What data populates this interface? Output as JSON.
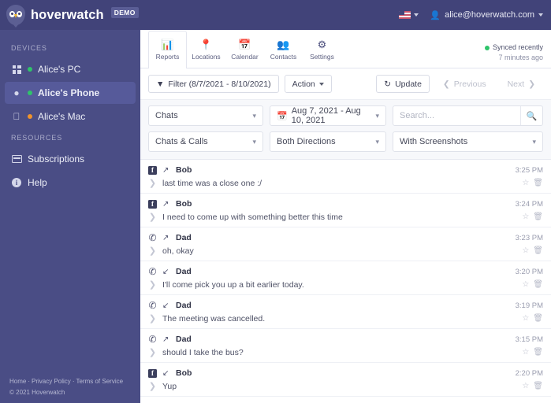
{
  "topbar": {
    "brand": "hoverwatch",
    "demo_badge": "DEMO",
    "language_icon": "us-flag-icon",
    "account_icon": "user-icon",
    "account_email": "alice@hoverwatch.com"
  },
  "sidebar": {
    "devices_heading": "DEVICES",
    "devices": [
      {
        "label": "Alice's PC",
        "icon": "windows-icon",
        "status": "green",
        "active": false
      },
      {
        "label": "Alice's Phone",
        "icon": "android-icon",
        "status": "green",
        "active": true
      },
      {
        "label": "Alice's Mac",
        "icon": "apple-icon",
        "status": "orange",
        "active": false
      }
    ],
    "resources_heading": "RESOURCES",
    "resources": [
      {
        "label": "Subscriptions",
        "icon": "card-icon"
      },
      {
        "label": "Help",
        "icon": "info-icon"
      }
    ],
    "footer_links": [
      "Home",
      "Privacy Policy",
      "Terms of Service"
    ],
    "copyright": "© 2021 Hoverwatch"
  },
  "tabs": [
    {
      "label": "Reports",
      "icon": "chart-bar-icon",
      "active": true
    },
    {
      "label": "Locations",
      "icon": "map-pin-icon",
      "active": false
    },
    {
      "label": "Calendar",
      "icon": "calendar-icon",
      "active": false
    },
    {
      "label": "Contacts",
      "icon": "people-icon",
      "active": false
    },
    {
      "label": "Settings",
      "icon": "gears-icon",
      "active": false
    }
  ],
  "sync": {
    "status": "Synced recently",
    "time_ago": "7 minutes ago",
    "status_color": "#2fc46a"
  },
  "toolbar": {
    "filter_label": "Filter (8/7/2021 - 8/10/2021)",
    "filter_icon": "funnel-icon",
    "action_label": "Action",
    "update_label": "Update",
    "update_icon": "refresh-icon",
    "previous_label": "Previous",
    "next_label": "Next"
  },
  "filters": {
    "type_select": "Chats",
    "date_range": "Aug 7, 2021 - Aug 10, 2021",
    "date_icon": "calendar-icon",
    "search_placeholder": "Search...",
    "search_value": "",
    "search_icon": "search-icon",
    "category_select": "Chats & Calls",
    "direction_select": "Both Directions",
    "screenshots_select": "With Screenshots"
  },
  "messages": [
    {
      "channel": "facebook",
      "direction": "outgoing",
      "sender": "Bob",
      "time": "3:25 PM",
      "text": "last time was a close one :/"
    },
    {
      "channel": "facebook",
      "direction": "outgoing",
      "sender": "Bob",
      "time": "3:24 PM",
      "text": "I need to come up with something better this time"
    },
    {
      "channel": "whatsapp",
      "direction": "outgoing",
      "sender": "Dad",
      "time": "3:23 PM",
      "text": "oh, okay"
    },
    {
      "channel": "whatsapp",
      "direction": "incoming",
      "sender": "Dad",
      "time": "3:20 PM",
      "text": "I'll come pick you up a bit earlier today."
    },
    {
      "channel": "whatsapp",
      "direction": "incoming",
      "sender": "Dad",
      "time": "3:19 PM",
      "text": "The meeting was cancelled."
    },
    {
      "channel": "whatsapp",
      "direction": "outgoing",
      "sender": "Dad",
      "time": "3:15 PM",
      "text": "should I take the bus?"
    },
    {
      "channel": "facebook",
      "direction": "incoming",
      "sender": "Bob",
      "time": "2:20 PM",
      "text": "Yup"
    }
  ],
  "row_actions": {
    "star_icon": "star-icon",
    "delete_icon": "trash-icon",
    "expand_icon": "chevron-right-icon"
  },
  "colors": {
    "brand_purple": "#414379",
    "sidebar_purple": "#4a4d85",
    "active_purple": "#565a9a",
    "green": "#2fc46a",
    "orange": "#f0932b"
  }
}
